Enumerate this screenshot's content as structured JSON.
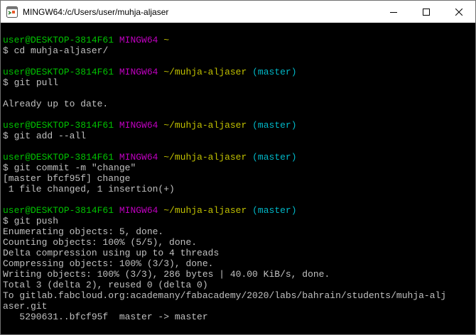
{
  "window": {
    "title": "MINGW64:/c/Users/user/muhja-aljaser",
    "icons": {
      "app": "git-bash-icon",
      "minimize": "minimize-icon",
      "maximize": "maximize-icon",
      "close": "close-icon"
    }
  },
  "colors": {
    "background": "#000000",
    "text": "#c0c0c0",
    "user_host": "#00c200",
    "mingw": "#c000c0",
    "path": "#c0c000",
    "branch": "#00b8c8"
  },
  "prompt": {
    "user_host": "user@DESKTOP-3814F61",
    "env": "MINGW64",
    "symbol": "$"
  },
  "session": {
    "p1": {
      "path": "~",
      "command": "cd muhja-aljaser/"
    },
    "p2": {
      "path": "~/muhja-aljaser",
      "branch": "(master)",
      "command": "git pull"
    },
    "out2": [
      "",
      "Already up to date."
    ],
    "p3": {
      "path": "~/muhja-aljaser",
      "branch": "(master)",
      "command": "git add --all"
    },
    "p4": {
      "path": "~/muhja-aljaser",
      "branch": "(master)",
      "command": "git commit -m \"change\""
    },
    "out4": [
      "[master bfcf95f] change",
      " 1 file changed, 1 insertion(+)"
    ],
    "p5": {
      "path": "~/muhja-aljaser",
      "branch": "(master)",
      "command": "git push"
    },
    "out5": [
      "Enumerating objects: 5, done.",
      "Counting objects: 100% (5/5), done.",
      "Delta compression using up to 4 threads",
      "Compressing objects: 100% (3/3), done.",
      "Writing objects: 100% (3/3), 286 bytes | 40.00 KiB/s, done.",
      "Total 3 (delta 2), reused 0 (delta 0)",
      "To gitlab.fabcloud.org:academany/fabacademy/2020/labs/bahrain/students/muhja-alj",
      "aser.git",
      "   5290631..bfcf95f  master -> master"
    ]
  }
}
